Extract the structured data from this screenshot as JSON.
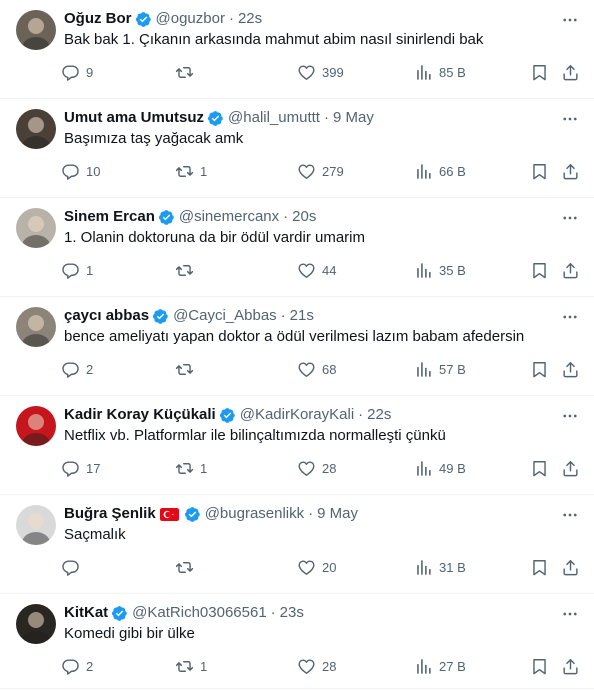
{
  "tweets": [
    {
      "name": "Oğuz Bor",
      "handle": "@oguzbor",
      "time": "22s",
      "text": "Bak bak 1. Çıkanın arkasında mahmut abim nasıl sinirlendi bak",
      "replies": "9",
      "retweets": "",
      "likes": "399",
      "views": "85 B",
      "avatar_color": "#6b6358",
      "has_flag": false
    },
    {
      "name": "Umut ama Umutsuz",
      "handle": "@halil_umuttt",
      "time": "9 May",
      "text": "Başımıza taş yağacak amk",
      "replies": "10",
      "retweets": "1",
      "likes": "279",
      "views": "66 B",
      "avatar_color": "#4a4038",
      "has_flag": false
    },
    {
      "name": "Sinem Ercan",
      "handle": "@sinemercanx",
      "time": "20s",
      "text": "1. Olanin doktoruna da bir ödül vardir umarim",
      "replies": "1",
      "retweets": "",
      "likes": "44",
      "views": "35 B",
      "avatar_color": "#b9b2a8",
      "has_flag": false
    },
    {
      "name": "çaycı abbas",
      "handle": "@Cayci_Abbas",
      "time": "21s",
      "text": "bence ameliyatı yapan doktor a ödül verilmesi lazım babam afedersin",
      "replies": "2",
      "retweets": "",
      "likes": "68",
      "views": "57 B",
      "avatar_color": "#8c8478",
      "has_flag": false
    },
    {
      "name": "Kadir Koray Küçükali",
      "handle": "@KadirKorayKali",
      "time": "22s",
      "text": "Netflix vb. Platformlar ile bilinçaltımızda normalleşti çünkü",
      "replies": "17",
      "retweets": "1",
      "likes": "28",
      "views": "49 B",
      "avatar_color": "#c4161c",
      "has_flag": false
    },
    {
      "name": "Buğra Şenlik",
      "handle": "@bugrasenlikk",
      "time": "9 May",
      "text": "Saçmalık",
      "replies": "",
      "retweets": "",
      "likes": "20",
      "views": "31 B",
      "avatar_color": "#d9d9d9",
      "has_flag": true
    },
    {
      "name": "KitKat",
      "handle": "@KatRich03066561",
      "time": "23s",
      "text": "Komedi gibi bir ülke",
      "replies": "2",
      "retweets": "1",
      "likes": "28",
      "views": "27 B",
      "avatar_color": "#2a2622",
      "has_flag": false
    }
  ],
  "icons": {
    "verified": "verified-badge-icon",
    "more": "more-icon",
    "reply": "reply-icon",
    "retweet": "retweet-icon",
    "like": "like-icon",
    "views": "views-icon",
    "bookmark": "bookmark-icon",
    "share": "share-icon",
    "flag": "turkey-flag-icon"
  },
  "colors": {
    "verified": "#1d9bf0",
    "muted": "#536471",
    "text": "#0f1419",
    "divider": "#eff3f4"
  }
}
